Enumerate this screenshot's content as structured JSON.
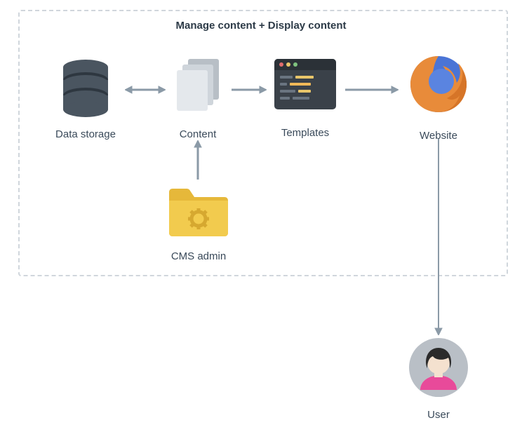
{
  "title": "Manage content + Display content",
  "nodes": {
    "data_storage": {
      "label": "Data storage"
    },
    "content": {
      "label": "Content"
    },
    "templates": {
      "label": "Templates"
    },
    "website": {
      "label": "Website"
    },
    "cms_admin": {
      "label": "CMS admin"
    },
    "user": {
      "label": "User"
    }
  },
  "icons": {
    "data_storage": "database-icon",
    "content": "documents-icon",
    "templates": "code-window-icon",
    "website": "firefox-icon",
    "cms_admin": "folder-gear-icon",
    "user": "person-avatar-icon"
  },
  "arrows": [
    {
      "from": "data_storage",
      "to": "content",
      "bidirectional": true
    },
    {
      "from": "content",
      "to": "templates",
      "bidirectional": false
    },
    {
      "from": "templates",
      "to": "website",
      "bidirectional": false
    },
    {
      "from": "cms_admin",
      "to": "content",
      "bidirectional": false
    },
    {
      "from": "website",
      "to": "user",
      "bidirectional": false
    }
  ]
}
